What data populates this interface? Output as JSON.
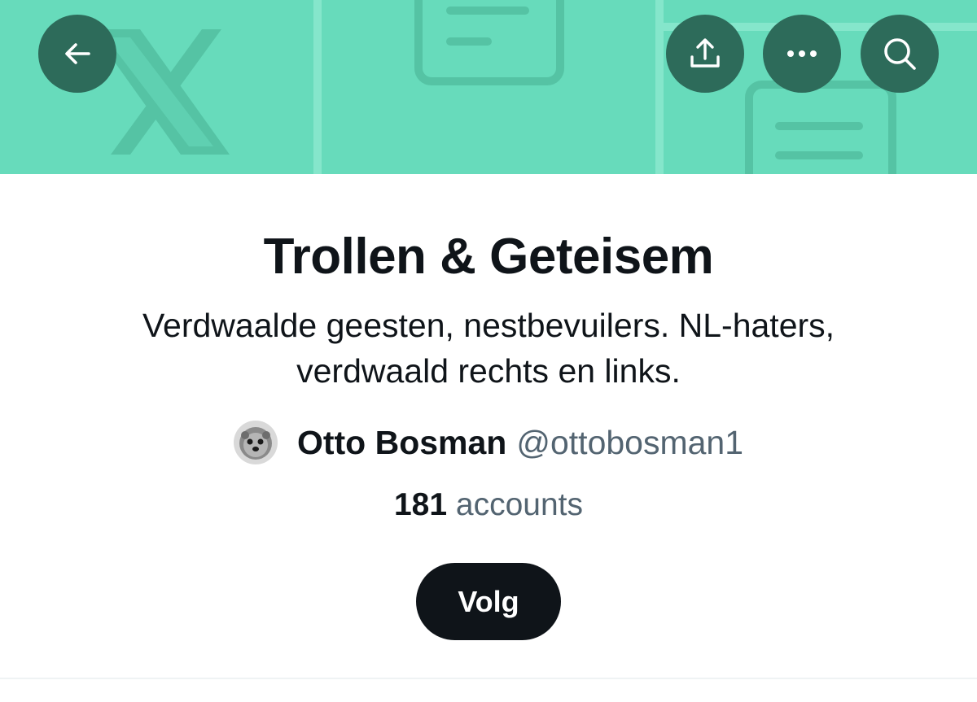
{
  "header": {
    "back_icon": "arrow-left-icon",
    "share_icon": "share-upload-icon",
    "more_icon": "more-dots-icon",
    "search_icon": "search-icon",
    "banner_color": "#67dbbb",
    "button_color": "#2d6b5a"
  },
  "list": {
    "title": "Trollen & Geteisem",
    "description": "Verdwaalde geesten, nestbevuilers. NL-haters, verdwaald rechts en links.",
    "owner_name": "Otto Bosman",
    "owner_handle": "@ottobosman1",
    "member_count": "181",
    "member_label": "accounts",
    "follow_label": "Volg"
  }
}
